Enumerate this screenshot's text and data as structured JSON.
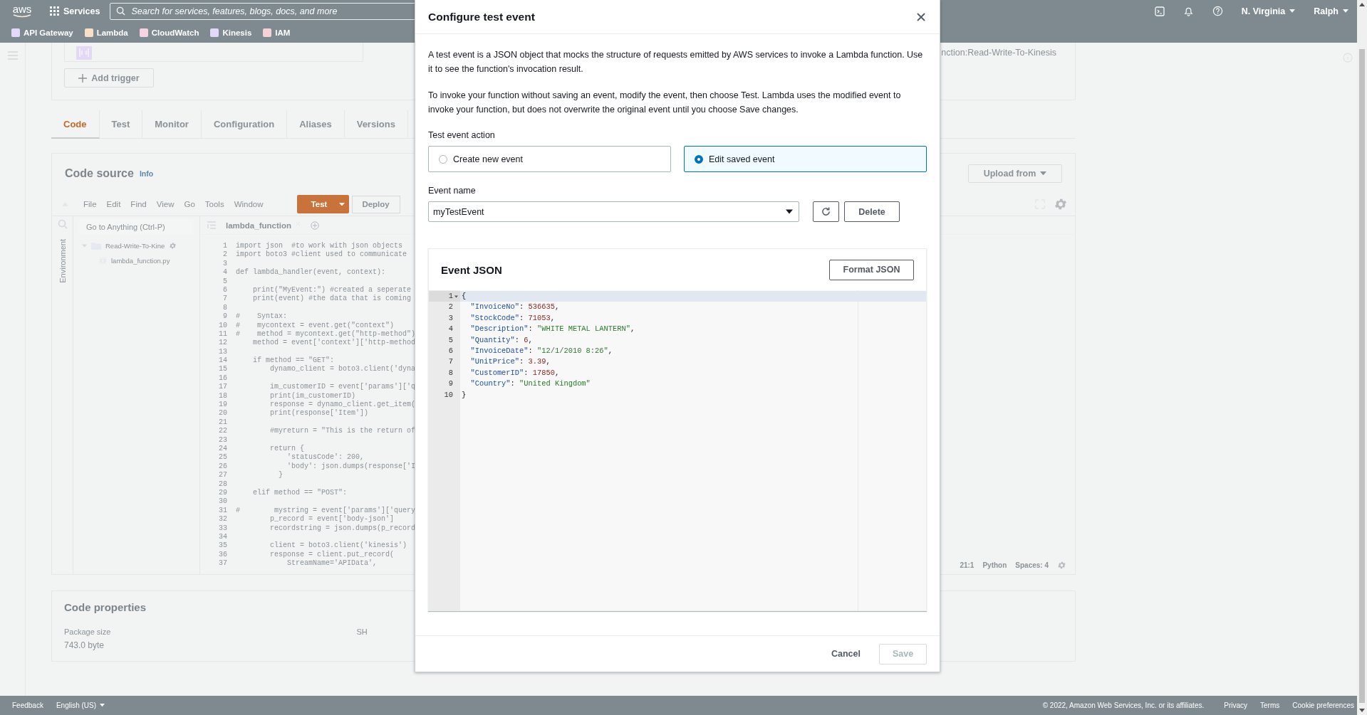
{
  "top_nav": {
    "logo": "aws",
    "services": "Services",
    "search": {
      "placeholder": "Search for services, features, blogs, docs, and more"
    },
    "region": "N. Virginia",
    "user": "Ralph"
  },
  "favorites": [
    {
      "label": "API Gateway",
      "color": "#e2d8f7"
    },
    {
      "label": "Lambda",
      "color": "#f7dfc8"
    },
    {
      "label": "CloudWatch",
      "color": "#f4d3e2"
    },
    {
      "label": "Kinesis",
      "color": "#e2d8f7"
    },
    {
      "label": "IAM",
      "color": "#f4d3d7"
    }
  ],
  "function_overview": {
    "arn_fragment": "nction:Read-Write-To-Kinesis",
    "add_trigger": "Add trigger"
  },
  "tabs": [
    {
      "label": "Code",
      "selected": true
    },
    {
      "label": "Test",
      "selected": false
    },
    {
      "label": "Monitor",
      "selected": false
    },
    {
      "label": "Configuration",
      "selected": false
    },
    {
      "label": "Aliases",
      "selected": false
    },
    {
      "label": "Versions",
      "selected": false
    }
  ],
  "code_source": {
    "title": "Code source",
    "info": "Info",
    "upload": "Upload from",
    "menu": [
      "File",
      "Edit",
      "Find",
      "View",
      "Go",
      "Tools",
      "Window"
    ],
    "test": "Test",
    "deploy": "Deploy",
    "search": {
      "placeholder": "Go to Anything (Ctrl-P)"
    },
    "environment": "Environment",
    "tree": [
      {
        "name": "Read-Write-To-Kine",
        "expanded": true,
        "children": [
          {
            "name": "lambda_function.py"
          }
        ]
      }
    ],
    "file_tab": "lambda_function",
    "lines": [
      {
        "number": "1",
        "text": "import json  #to work with json objects"
      },
      {
        "number": "2",
        "text": "import boto3 #client used to communicate"
      },
      {
        "number": "3"
      },
      {
        "number": "4",
        "text": "def lambda_handler(event, context):"
      },
      {
        "number": "5"
      },
      {
        "number": "6",
        "text": "    print(\"MyEvent:\") #created a seperate"
      },
      {
        "number": "7",
        "text": "    print(event) #the data that is coming"
      },
      {
        "number": "8"
      },
      {
        "number": "9",
        "text": "#    Syntax:"
      },
      {
        "number": "10",
        "text": "#    mycontext = event.get(\"context\")"
      },
      {
        "number": "11",
        "text": "#    method = mycontext.get(\"http-method\")"
      },
      {
        "number": "12",
        "text": "    method = event['context']['http-method"
      },
      {
        "number": "13"
      },
      {
        "number": "14",
        "text": "    if method == \"GET\":"
      },
      {
        "number": "15",
        "text": "        dynamo_client = boto3.client('dyna"
      },
      {
        "number": "16"
      },
      {
        "number": "17",
        "text": "        im_customerID = event['params']['q"
      },
      {
        "number": "18",
        "text": "        print(im_customerID)"
      },
      {
        "number": "19",
        "text": "        response = dynamo_client.get_item("
      },
      {
        "number": "20",
        "text": "        print(response['Item'])"
      },
      {
        "number": "21"
      },
      {
        "number": "22",
        "text": "        #myreturn = \"This is the return of"
      },
      {
        "number": "23"
      },
      {
        "number": "24",
        "text": "        return {"
      },
      {
        "number": "25",
        "text": "            'statusCode': 200,"
      },
      {
        "number": "26",
        "text": "            'body': json.dumps(response['I"
      },
      {
        "number": "27",
        "text": "          }"
      },
      {
        "number": "28"
      },
      {
        "number": "29",
        "text": "    elif method == \"POST\":"
      },
      {
        "number": "30"
      },
      {
        "number": "31",
        "text": "#        mystring = event['params']['query"
      },
      {
        "number": "32",
        "text": "        p_record = event['body-json']"
      },
      {
        "number": "33",
        "text": "        recordstring = json.dumps(p_record"
      },
      {
        "number": "34"
      },
      {
        "number": "35",
        "text": "        client = boto3.client('kinesis')"
      },
      {
        "number": "36",
        "text": "        response = client.put_record("
      },
      {
        "number": "37",
        "text": "            StreamName='APIData',"
      }
    ],
    "status": [
      "21:1",
      "Python",
      "Spaces: 4"
    ]
  },
  "code_properties": {
    "title": "Code properties",
    "package_label": "Package size",
    "package_value": "743.0 byte",
    "column_2_label": "SH"
  },
  "footer": {
    "feedback": "Feedback",
    "language": "English (US)",
    "copyright": "© 2022, Amazon Web Services, Inc. or its affiliates.",
    "links": [
      "Privacy",
      "Terms",
      "Cookie preferences"
    ]
  },
  "dialog": {
    "title": "Configure test event",
    "paragraphs": [
      "A test event is a JSON object that mocks the structure of requests emitted by AWS services to invoke a Lambda function. Use it to see the function's invocation result.",
      "To invoke your function without saving an event, modify the event, then choose Test. Lambda uses the modified event to invoke your function, but does not overwrite the original event until you choose Save changes."
    ],
    "action_label": "Test event action",
    "actions": [
      {
        "label": "Create new event",
        "selected": false
      },
      {
        "label": "Edit saved event",
        "selected": true
      }
    ],
    "event_name_label": "Event name",
    "event_name": "myTestEvent",
    "delete": "Delete",
    "json_title": "Event JSON",
    "format": "Format JSON",
    "json_lines": [
      {
        "number": "1",
        "fold": true,
        "active": true,
        "tokens": [
          {
            "kind": "punct",
            "text": "{"
          }
        ]
      },
      {
        "number": "2",
        "fold": false,
        "active": false,
        "tokens": [
          {
            "kind": "key",
            "text": "  \"InvoiceNo\""
          },
          {
            "kind": "punct",
            "text": ": "
          },
          {
            "kind": "number",
            "text": "536635"
          },
          {
            "kind": "punct",
            "text": ","
          }
        ]
      },
      {
        "number": "3",
        "fold": false,
        "active": false,
        "tokens": [
          {
            "kind": "key",
            "text": "  \"StockCode\""
          },
          {
            "kind": "punct",
            "text": ": "
          },
          {
            "kind": "number",
            "text": "71053"
          },
          {
            "kind": "punct",
            "text": ","
          }
        ]
      },
      {
        "number": "4",
        "fold": false,
        "active": false,
        "tokens": [
          {
            "kind": "key",
            "text": "  \"Description\""
          },
          {
            "kind": "punct",
            "text": ": "
          },
          {
            "kind": "string",
            "text": "\"WHITE METAL LANTERN\""
          },
          {
            "kind": "punct",
            "text": ","
          }
        ]
      },
      {
        "number": "5",
        "fold": false,
        "active": false,
        "tokens": [
          {
            "kind": "key",
            "text": "  \"Quantity\""
          },
          {
            "kind": "punct",
            "text": ": "
          },
          {
            "kind": "number",
            "text": "6"
          },
          {
            "kind": "punct",
            "text": ","
          }
        ]
      },
      {
        "number": "6",
        "fold": false,
        "active": false,
        "tokens": [
          {
            "kind": "key",
            "text": "  \"InvoiceDate\""
          },
          {
            "kind": "punct",
            "text": ": "
          },
          {
            "kind": "string",
            "text": "\"12/1/2010 8:26\""
          },
          {
            "kind": "punct",
            "text": ","
          }
        ]
      },
      {
        "number": "7",
        "fold": false,
        "active": false,
        "tokens": [
          {
            "kind": "key",
            "text": "  \"UnitPrice\""
          },
          {
            "kind": "punct",
            "text": ": "
          },
          {
            "kind": "number",
            "text": "3.39"
          },
          {
            "kind": "punct",
            "text": ","
          }
        ]
      },
      {
        "number": "8",
        "fold": false,
        "active": false,
        "tokens": [
          {
            "kind": "key",
            "text": "  \"CustomerID\""
          },
          {
            "kind": "punct",
            "text": ": "
          },
          {
            "kind": "number",
            "text": "17850"
          },
          {
            "kind": "punct",
            "text": ","
          }
        ]
      },
      {
        "number": "9",
        "fold": false,
        "active": false,
        "tokens": [
          {
            "kind": "key",
            "text": "  \"Country\""
          },
          {
            "kind": "punct",
            "text": ": "
          },
          {
            "kind": "string",
            "text": "\"United Kingdom\""
          }
        ]
      },
      {
        "number": "10",
        "fold": false,
        "active": false,
        "tokens": [
          {
            "kind": "punct",
            "text": "}"
          }
        ]
      }
    ],
    "cancel": "Cancel",
    "save": {
      "label": "Save",
      "disabled": true
    }
  }
}
